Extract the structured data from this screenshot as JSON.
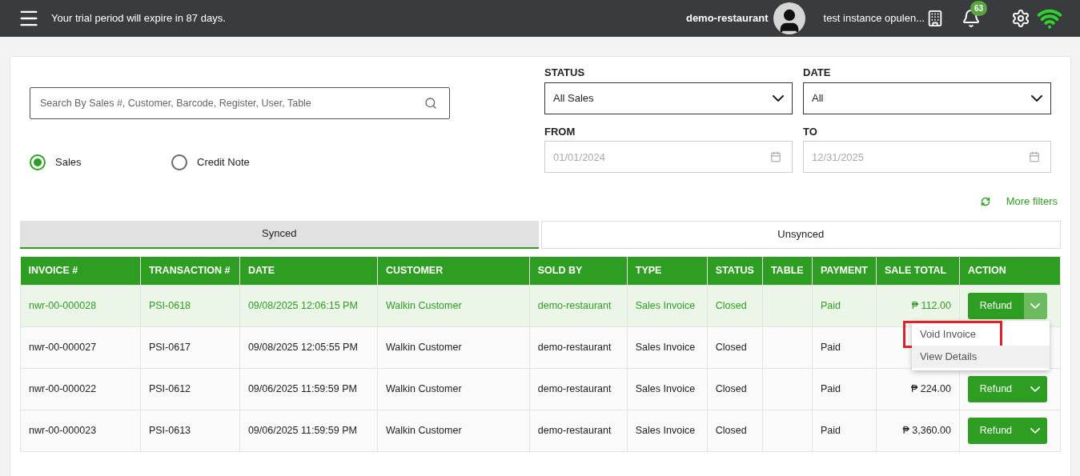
{
  "header": {
    "trial_notice": "Your trial period will expire in 87 days.",
    "user_name": "demo-restaurant",
    "instance_name": "test instance opulen...",
    "notification_count": "63"
  },
  "search": {
    "placeholder": "Search By Sales #, Customer, Barcode, Register, User, Table"
  },
  "record_type": [
    {
      "label": "Sales",
      "selected": true
    },
    {
      "label": "Credit Note",
      "selected": false
    }
  ],
  "filters": {
    "status": {
      "label": "STATUS",
      "value": "All Sales"
    },
    "date": {
      "label": "DATE",
      "value": "All"
    },
    "from": {
      "label": "FROM",
      "placeholder": "01/01/2024"
    },
    "to": {
      "label": "TO",
      "placeholder": "12/31/2025"
    }
  },
  "more_filters": "More filters",
  "sync_tabs": [
    {
      "label": "Synced",
      "selected": true
    },
    {
      "label": "Unsynced",
      "selected": false
    }
  ],
  "table": {
    "columns": [
      "INVOICE #",
      "TRANSACTION #",
      "DATE",
      "CUSTOMER",
      "SOLD BY",
      "TYPE",
      "STATUS",
      "TABLE",
      "PAYMENT",
      "SALE TOTAL",
      "ACTION"
    ],
    "rows": [
      {
        "selected": true,
        "invoice": "nwr-00-000028",
        "transaction": "PSI-0618",
        "date": "09/08/2025 12:06:15 PM",
        "customer": "Walkin Customer",
        "sold_by": "demo-restaurant",
        "type": "Sales Invoice",
        "status": "Closed",
        "payment": "Paid",
        "total": "₱ 112.00",
        "action": {
          "label": "Refund",
          "menu_open": true
        }
      },
      {
        "selected": false,
        "invoice": "nwr-00-000027",
        "transaction": "PSI-0617",
        "date": "09/08/2025 12:05:55 PM",
        "customer": "Walkin Customer",
        "sold_by": "demo-restaurant",
        "type": "Sales Invoice",
        "status": "Closed",
        "payment": "Paid"
      },
      {
        "selected": false,
        "invoice": "nwr-00-000022",
        "transaction": "PSI-0612",
        "date": "09/06/2025 11:59:59 PM",
        "customer": "Walkin Customer",
        "sold_by": "demo-restaurant",
        "type": "Sales Invoice",
        "status": "Closed",
        "payment": "Paid",
        "total": "₱ 224.00",
        "action": {
          "label": "Refund",
          "menu_open": false
        }
      },
      {
        "selected": false,
        "invoice": "nwr-00-000023",
        "transaction": "PSI-0613",
        "date": "09/06/2025 11:59:59 PM",
        "customer": "Walkin Customer",
        "sold_by": "demo-restaurant",
        "type": "Sales Invoice",
        "status": "Closed",
        "payment": "Paid",
        "total": "₱ 3,360.00",
        "action": {
          "label": "Refund",
          "menu_open": false
        }
      }
    ],
    "action_menu": [
      {
        "label": "Void Invoice",
        "highlighted": true,
        "hovered": false
      },
      {
        "label": "View Details",
        "highlighted": false,
        "hovered": true
      }
    ]
  }
}
